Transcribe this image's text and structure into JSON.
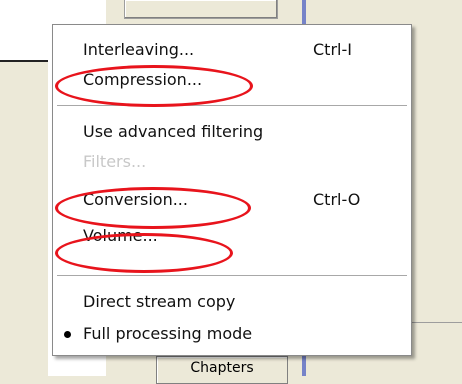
{
  "background": {
    "bottom_button_label": "Chapters"
  },
  "menu": {
    "items": [
      {
        "label": "Interleaving...",
        "shortcut": "Ctrl-I",
        "enabled": true
      },
      {
        "label": "Compression...",
        "shortcut": "",
        "enabled": true
      },
      {
        "label": "Use advanced filtering",
        "shortcut": "",
        "enabled": true
      },
      {
        "label": "Filters...",
        "shortcut": "",
        "enabled": false
      },
      {
        "label": "Conversion...",
        "shortcut": "Ctrl-O",
        "enabled": true
      },
      {
        "label": "Volume...",
        "shortcut": "",
        "enabled": true
      },
      {
        "label": "Direct stream copy",
        "shortcut": "",
        "enabled": true
      },
      {
        "label": "Full processing mode",
        "shortcut": "",
        "enabled": true,
        "selected": true
      }
    ]
  },
  "colors": {
    "highlight_circle": "#e8141c",
    "disabled_text": "#c8c8c8",
    "scroll_accent": "#7683c8"
  }
}
